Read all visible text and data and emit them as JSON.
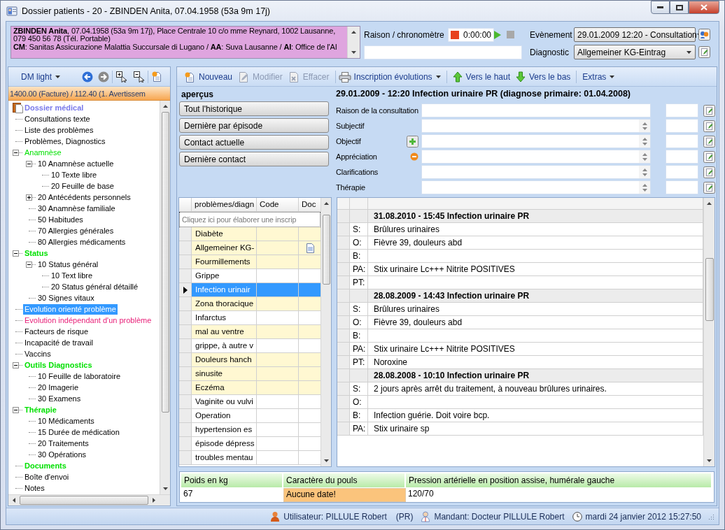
{
  "window": {
    "title": "Dossier patients - 20 - ZBINDEN Anita, 07.04.1958 (53a 9m 17j)"
  },
  "patient": {
    "summary": "**ZBINDEN Anita**, 07.04.1958 (53a 9m 17j), Place Centrale 10 c/o mme Reynard, 1002 Lausanne, 079 450 56 78 (Tél. Portable)",
    "insurance": "**CM**: Sanitas Assicurazione Malattia Succursale di Lugano / **AA**: Suva Lausanne / **AI**: Office de l'AI"
  },
  "consultation": {
    "reason_label": "Raison / chronomètre",
    "timer": "0:00:00",
    "event_label": "Evènement",
    "event": "29.01.2009 12:20 - Consultation",
    "diagnostic_label": "Diagnostic",
    "diagnostic": "Allgemeiner KG-Eintrag"
  },
  "navigator": {
    "view": "DM light",
    "balance": "1400.00 (Facture) / 112.40 (1. Avertissem",
    "tree": [
      {
        "label": "Dossier médical",
        "color": "#7878ea",
        "bold": true,
        "selected": false
      },
      {
        "label": "Consultations texte",
        "selected": false
      },
      {
        "label": "Liste des problèmes",
        "selected": false
      },
      {
        "label": "Problèmes, Diagnostics",
        "selected": false
      },
      {
        "label": "Anamnèse",
        "color": "#00e000",
        "bold": false,
        "selected": false,
        "expanded": true,
        "children": [
          {
            "label": "10 Anamnèse actuelle",
            "selected": false,
            "expanded": true,
            "children": [
              {
                "label": "10 Texte libre",
                "selected": false
              },
              {
                "label": "20 Feuille de base",
                "selected": false
              }
            ]
          },
          {
            "label": "20 Antécédents personnels",
            "selected": false,
            "expanded": false
          },
          {
            "label": "30 Anamnèse familiale",
            "selected": false
          },
          {
            "label": "50 Habitudes",
            "selected": false
          },
          {
            "label": "70 Allergies générales",
            "selected": false
          },
          {
            "label": "80 Allergies médicaments",
            "selected": false
          }
        ]
      },
      {
        "label": "Status",
        "color": "#00e000",
        "bold": true,
        "selected": false,
        "expanded": true,
        "children": [
          {
            "label": "10 Status général",
            "selected": false,
            "expanded": true,
            "children": [
              {
                "label": "10 Text libre",
                "selected": false
              },
              {
                "label": "20 Status général détaillé",
                "selected": false
              }
            ]
          },
          {
            "label": "30 Signes vitaux",
            "selected": false
          }
        ]
      },
      {
        "label": "Evolution orienté problème",
        "selected": true
      },
      {
        "label": "Evolution indépendant d'un problème",
        "color": "#e8227a",
        "bold": false,
        "selected": false
      },
      {
        "label": "Facteurs de risque",
        "selected": false
      },
      {
        "label": "Incapacité de travail",
        "selected": false
      },
      {
        "label": "Vaccins",
        "selected": false
      },
      {
        "label": "Outils Diagnostics",
        "color": "#00e000",
        "bold": true,
        "selected": false,
        "expanded": true,
        "children": [
          {
            "label": "10 Feuille de laboratoire",
            "selected": false
          },
          {
            "label": "20 Imagerie",
            "selected": false
          },
          {
            "label": "30 Examens",
            "selected": false
          }
        ]
      },
      {
        "label": "Thérapie",
        "color": "#00e000",
        "bold": true,
        "selected": false,
        "expanded": true,
        "children": [
          {
            "label": "10 Médicaments",
            "selected": false
          },
          {
            "label": "15 Durée de médication",
            "selected": false
          },
          {
            "label": "20 Traitements",
            "selected": false
          },
          {
            "label": "30 Opérations",
            "selected": false
          }
        ]
      },
      {
        "label": "Documents",
        "color": "#00e000",
        "bold": true,
        "selected": false
      },
      {
        "label": "Boîte d'envoi",
        "selected": false
      },
      {
        "label": "Notes",
        "selected": false
      }
    ]
  },
  "toolbar": [
    {
      "label": "Nouveau",
      "kind": "button",
      "disabled": false
    },
    {
      "label": "Modifier",
      "kind": "button",
      "disabled": true
    },
    {
      "label": "Effacer",
      "kind": "button",
      "disabled": true
    },
    {
      "kind": "icon",
      "disabled": false
    },
    {
      "label": "Inscription évolutions",
      "kind": "menu",
      "disabled": false
    },
    {
      "label": "Vers le haut",
      "kind": "button",
      "disabled": false
    },
    {
      "label": "Vers le bas",
      "kind": "button",
      "disabled": false
    },
    {
      "label": "Extras",
      "kind": "menu",
      "disabled": false
    }
  ],
  "overview": {
    "title": "aperçus",
    "buttons": [
      "Tout l'historique",
      "Dernière par épisode",
      "Contact actuelle",
      "Dernière contact"
    ]
  },
  "entry": {
    "title": "29.01.2009 - 12:20 Infection urinaire PR (diagnose primaire: 01.04.2008)",
    "fields": [
      {
        "label": "Raison de la consultation",
        "kind": "line",
        "addable": false,
        "removable": false
      },
      {
        "label": "Subjectif",
        "kind": "memo",
        "addable": false,
        "removable": false
      },
      {
        "label": "Objectif",
        "kind": "memo",
        "addable": true,
        "removable": false
      },
      {
        "label": "Appréciation",
        "kind": "memo",
        "addable": false,
        "removable": true
      },
      {
        "label": "Clarifications",
        "kind": "memo",
        "addable": false,
        "removable": false
      },
      {
        "label": "Thérapie",
        "kind": "memo",
        "addable": false,
        "removable": false
      }
    ]
  },
  "problems": {
    "columns": [
      "problèmes/diagn",
      "Code",
      "Doc"
    ],
    "prompt": "Cliquez ici pour élaborer une inscrip",
    "rows": [
      {
        "name": "Diabète",
        "marked": true,
        "document": false,
        "selected": false
      },
      {
        "name": "Allgemeiner KG-",
        "marked": true,
        "document": true,
        "selected": false
      },
      {
        "name": "Fourmillements",
        "marked": true,
        "document": false,
        "selected": false
      },
      {
        "name": "Grippe",
        "marked": false,
        "document": false,
        "selected": false
      },
      {
        "name": "Infection urinair",
        "marked": false,
        "document": false,
        "selected": true
      },
      {
        "name": "Zona thoracique",
        "marked": true,
        "document": false,
        "selected": false
      },
      {
        "name": "Infarctus",
        "marked": false,
        "document": false,
        "selected": false
      },
      {
        "name": "mal au ventre",
        "marked": true,
        "document": false,
        "selected": false
      },
      {
        "name": "grippe, à autre v",
        "marked": false,
        "document": false,
        "selected": false
      },
      {
        "name": "Douleurs hanch",
        "marked": true,
        "document": false,
        "selected": false
      },
      {
        "name": "sinusite",
        "marked": true,
        "document": false,
        "selected": false
      },
      {
        "name": "Eczéma",
        "marked": true,
        "document": false,
        "selected": false
      },
      {
        "name": "Vaginite ou vulvi",
        "marked": false,
        "document": false,
        "selected": false
      },
      {
        "name": "Operation",
        "marked": false,
        "document": false,
        "selected": false
      },
      {
        "name": "hypertension es",
        "marked": false,
        "document": false,
        "selected": false
      },
      {
        "name": "épisode dépress",
        "marked": false,
        "document": false,
        "selected": false
      },
      {
        "name": "troubles mentau",
        "marked": false,
        "document": false,
        "selected": false
      }
    ]
  },
  "history": [
    {
      "title": "31.08.2010 - 15:45 Infection urinaire PR",
      "lines": [
        {
          "label": "S:",
          "text": "Brûlures urinaires"
        },
        {
          "label": "O:",
          "text": "Fièvre 39, douleurs abd"
        },
        {
          "label": "B:"
        },
        {
          "label": "PA:",
          "text": "Stix urinaire Lc+++ Nitrite POSITIVES"
        },
        {
          "label": "PT:"
        }
      ]
    },
    {
      "title": "28.08.2009 - 14:43 Infection urinaire PR",
      "lines": [
        {
          "label": "S:",
          "text": "Brûlures urinaires"
        },
        {
          "label": "O:",
          "text": "Fièvre 39, douleurs abd"
        },
        {
          "label": "B:"
        },
        {
          "label": "PA:",
          "text": "Stix urinaire Lc+++ Nitrite POSITIVES"
        },
        {
          "label": "PT:",
          "text": "Noroxine"
        }
      ]
    },
    {
      "title": "28.08.2008 - 10:10 Infection urinaire PR",
      "lines": [
        {
          "label": "S:",
          "text": "2 jours après arrêt du traitement, à nouveau brûlures urinaires."
        },
        {
          "label": "O:"
        },
        {
          "label": "B:",
          "text": "Infection guérie. Doit voire bcp."
        },
        {
          "label": "PA:",
          "text": "Stix urinaire sp"
        }
      ]
    }
  ],
  "vitals": [
    {
      "label": "Poids en kg",
      "value": "67",
      "warning": false
    },
    {
      "label": "Caractère du pouls",
      "value": "Aucune date!",
      "warning": true
    },
    {
      "label": "Pression artérielle en position assise, humérale gauche",
      "value": "120/70",
      "warning": false
    }
  ],
  "status_bar": {
    "user": "Utilisateur: PILLULE Robert",
    "initials": "(PR)",
    "mandant": "Mandant: Docteur PILLULE Robert",
    "datetime": "mardi 24 janvier 2012 15:27:50"
  }
}
